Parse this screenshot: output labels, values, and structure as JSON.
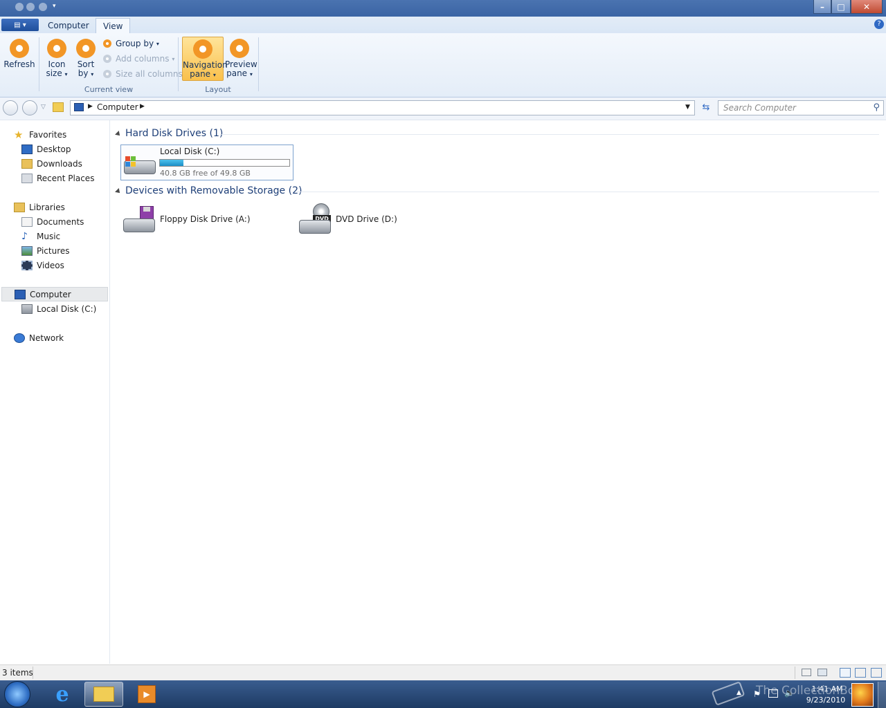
{
  "ribbon": {
    "tabs": [
      "Computer",
      "View"
    ],
    "buttons": {
      "refresh": "Refresh",
      "icon_size_1": "Icon",
      "icon_size_2": "size",
      "sort_by_1": "Sort",
      "sort_by_2": "by",
      "group_by": "Group by",
      "add_columns": "Add columns",
      "size_all_columns": "Size all columns",
      "navigation_pane_1": "Navigation",
      "navigation_pane_2": "pane",
      "preview_pane_1": "Preview",
      "preview_pane_2": "pane"
    },
    "groups": {
      "current_view": "Current view",
      "layout": "Layout"
    }
  },
  "address": {
    "crumb": "Computer",
    "search_placeholder": "Search Computer"
  },
  "nav": {
    "favorites": "Favorites",
    "desktop": "Desktop",
    "downloads": "Downloads",
    "recent_places": "Recent Places",
    "libraries": "Libraries",
    "documents": "Documents",
    "music": "Music",
    "pictures": "Pictures",
    "videos": "Videos",
    "computer": "Computer",
    "local_disk": "Local Disk (C:)",
    "network": "Network"
  },
  "content": {
    "hdd_group": "Hard Disk Drives (1)",
    "removable_group": "Devices with Removable Storage (2)",
    "local_disk": {
      "name": "Local Disk (C:)",
      "free_text": "40.8 GB free of 49.8 GB",
      "used_fraction": 0.18
    },
    "floppy": "Floppy Disk Drive (A:)",
    "dvd": "DVD Drive (D:)",
    "dvd_badge": "DVD"
  },
  "status": {
    "items": "3 items"
  },
  "taskbar": {
    "time": "1:41 AM",
    "date": "9/23/2010",
    "watermark": "The CollectionBook"
  },
  "colors": {
    "accent": "#f29626",
    "disk_bar": "#26a0da",
    "taskbar": "#1d3a63"
  }
}
